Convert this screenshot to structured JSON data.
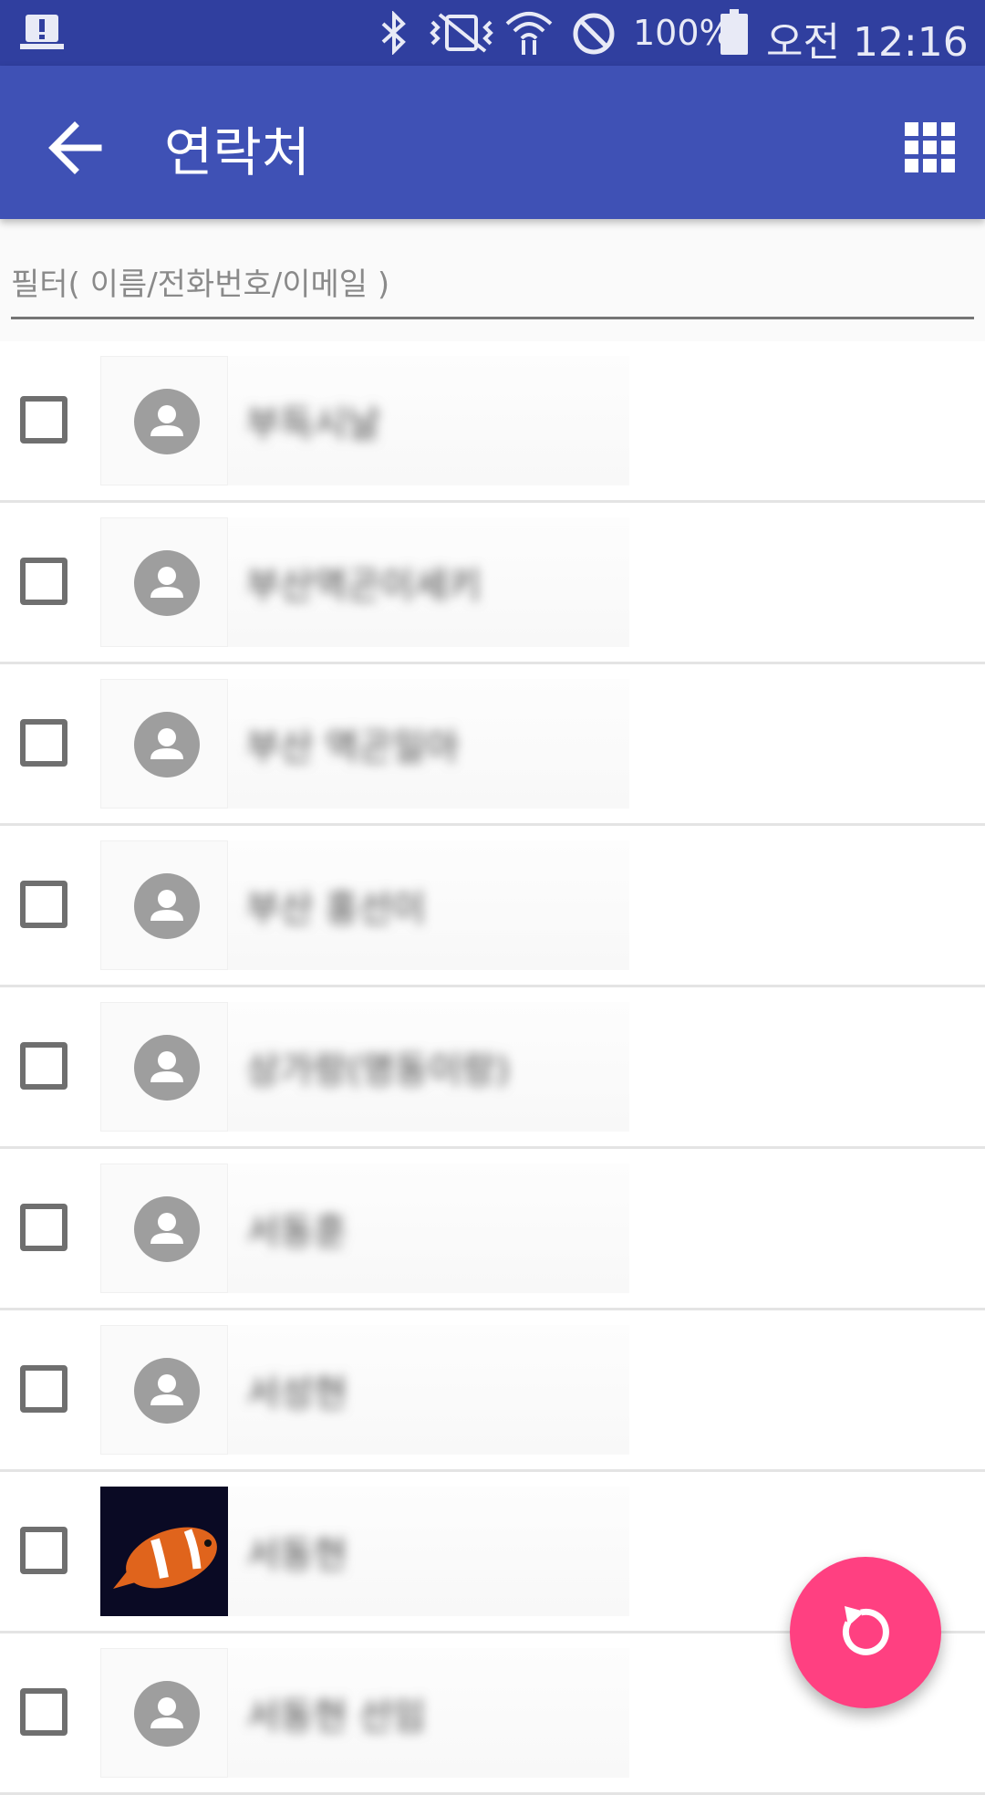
{
  "status_bar": {
    "battery_text": "100%",
    "time": "오전 12:16",
    "icons": [
      "alert-icon",
      "bluetooth-icon",
      "vibrate-icon",
      "wifi-icon",
      "do-not-disturb-icon",
      "battery-icon"
    ]
  },
  "app_bar": {
    "title": "연락처",
    "back_icon": "arrow-left-icon",
    "view_icon": "grid-view-icon"
  },
  "filter": {
    "placeholder": "필터( 이름/전화번호/이메일 )",
    "value": ""
  },
  "contacts": [
    {
      "name": "부득시날",
      "checked": false,
      "avatar": "default-person-icon"
    },
    {
      "name": "부산역곤이세키",
      "checked": false,
      "avatar": "default-person-icon"
    },
    {
      "name": "부산 역곤일아",
      "checked": false,
      "avatar": "default-person-icon"
    },
    {
      "name": "부산 홍선이",
      "checked": false,
      "avatar": "default-person-icon"
    },
    {
      "name": "상가랑(명동이랑)",
      "checked": false,
      "avatar": "default-person-icon"
    },
    {
      "name": "서동훈",
      "checked": false,
      "avatar": "default-person-icon"
    },
    {
      "name": "서성현",
      "checked": false,
      "avatar": "default-person-icon"
    },
    {
      "name": "서동현",
      "checked": false,
      "avatar": "clownfish-photo"
    },
    {
      "name": "서동현 선임",
      "checked": false,
      "avatar": "default-person-icon"
    }
  ],
  "fab": {
    "icon": "refresh-icon"
  },
  "colors": {
    "status_bar": "#303f9f",
    "app_bar": "#3f51b5",
    "fab": "#ff4081",
    "avatar": "#9e9e9e"
  }
}
